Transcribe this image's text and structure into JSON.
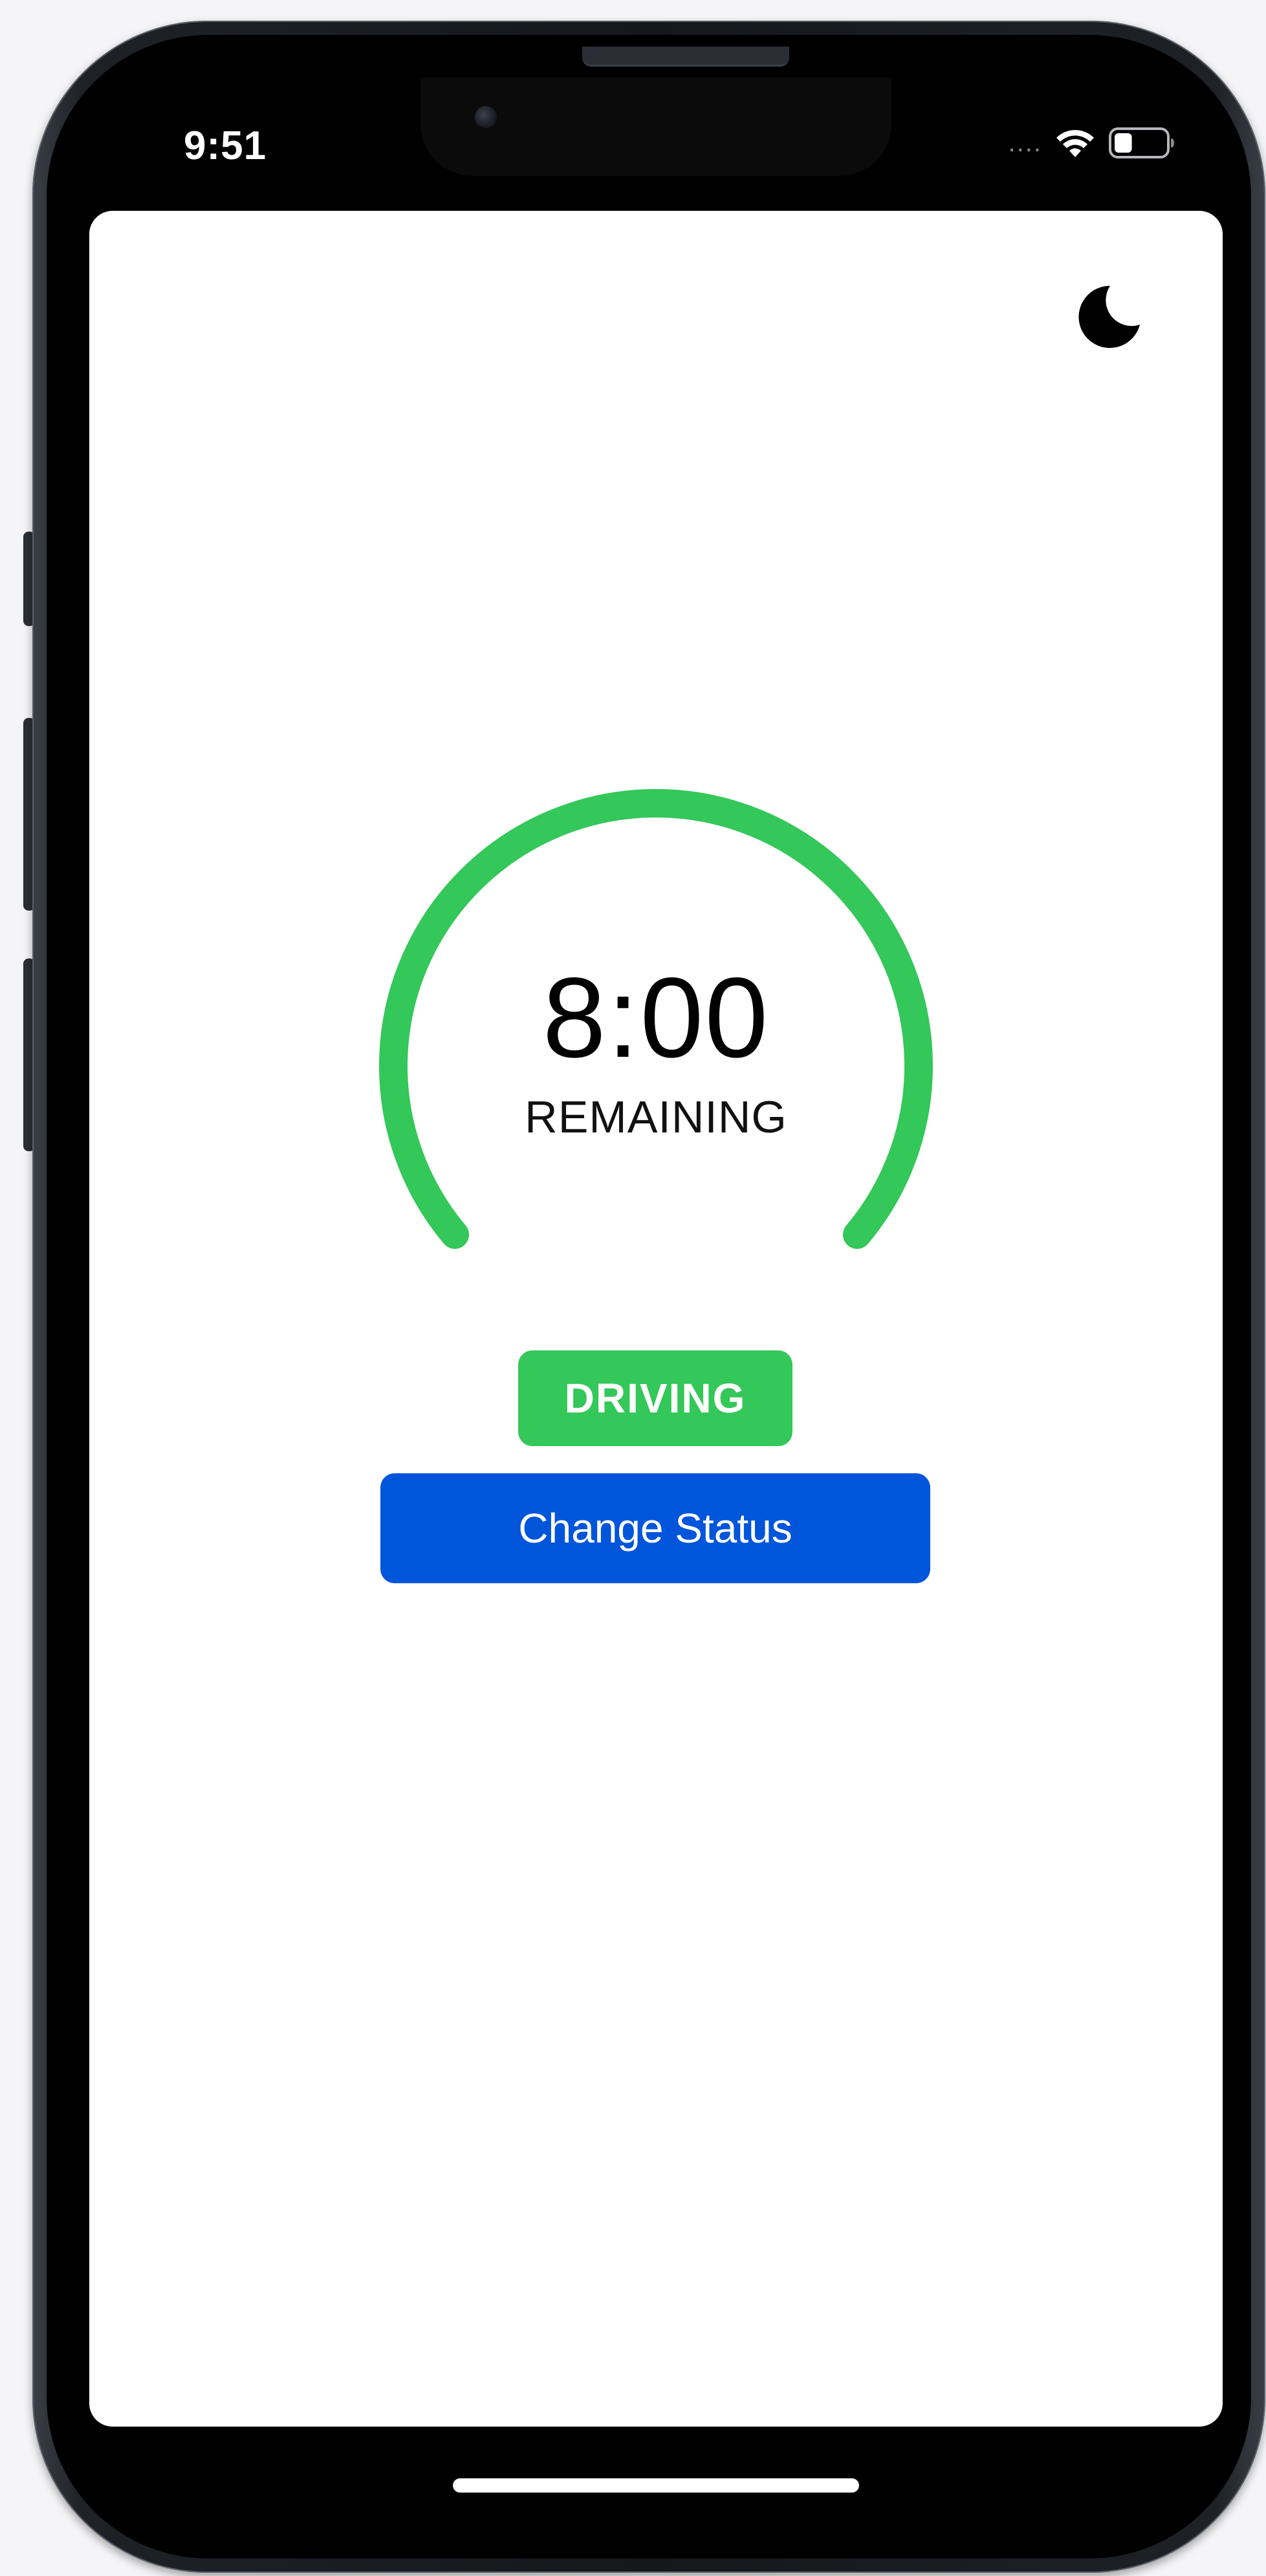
{
  "status_bar": {
    "time": "9:51",
    "signal": "....",
    "wifi_icon": "wifi-icon",
    "battery_icon": "battery-icon",
    "battery_level": 0.35
  },
  "header": {
    "theme_toggle_icon": "moon-icon"
  },
  "timer": {
    "value": "8:00",
    "label": "REMAINING",
    "progress": 1.0,
    "color": "#34c759"
  },
  "status": {
    "label": "DRIVING",
    "color": "#34c759"
  },
  "actions": {
    "change_status_label": "Change Status",
    "color": "#0055da"
  }
}
